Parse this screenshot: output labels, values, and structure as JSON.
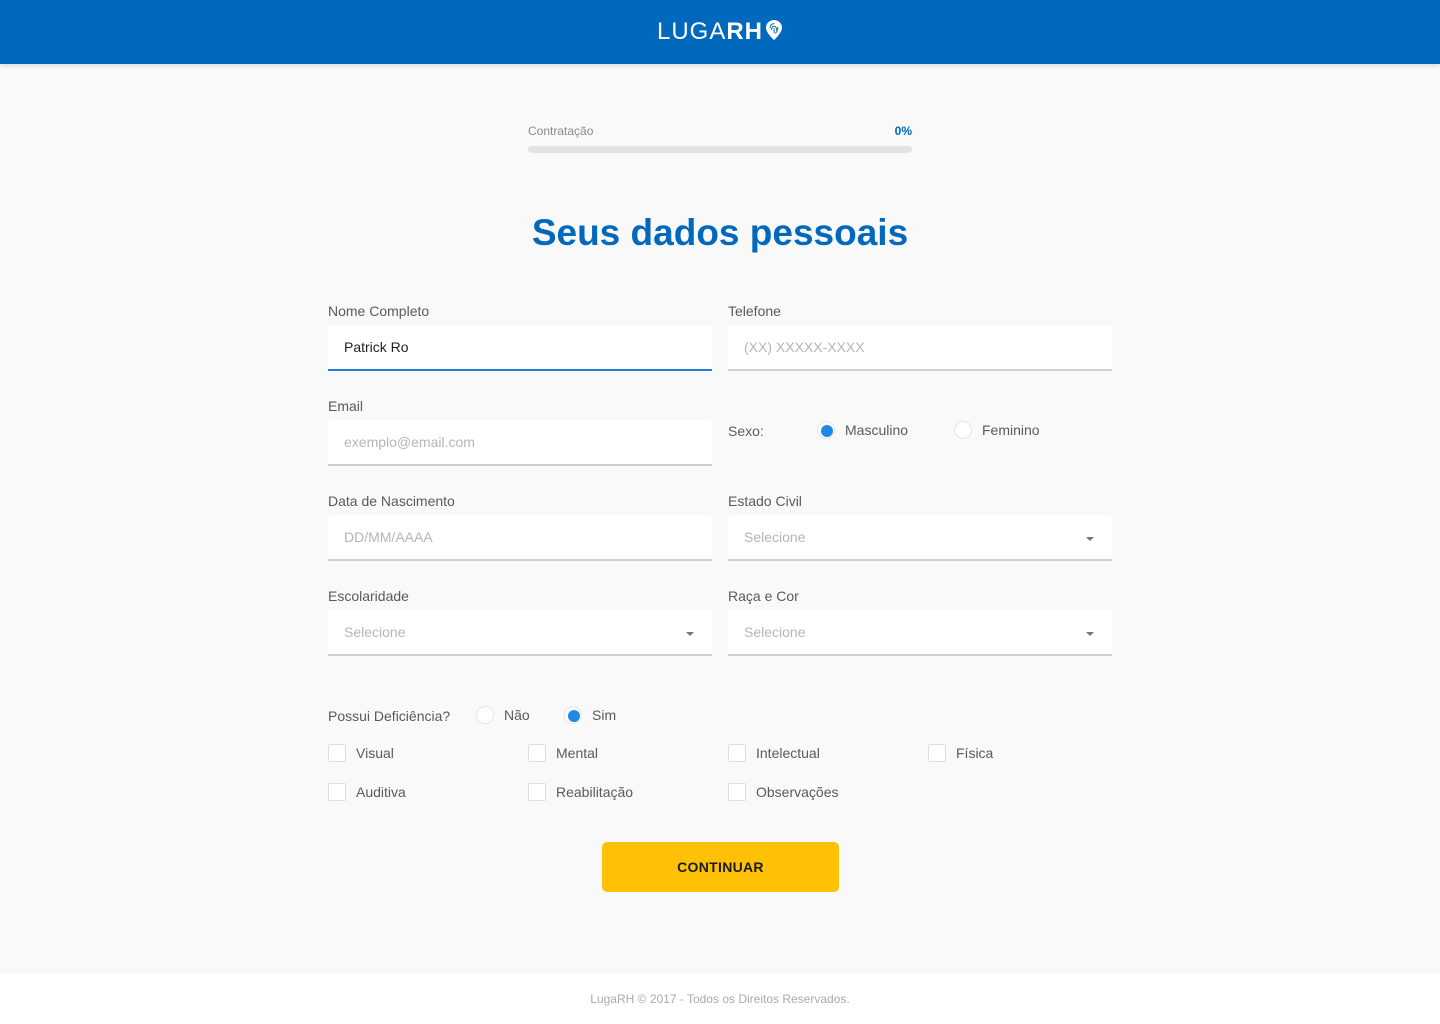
{
  "header": {
    "logo_light": "LUGA",
    "logo_bold": "RH",
    "logo_icon": "location-pin-icon"
  },
  "progress": {
    "label": "Contratação",
    "value_text": "0%",
    "value": 0
  },
  "page": {
    "title": "Seus dados pessoais"
  },
  "form": {
    "nome": {
      "label": "Nome Completo",
      "value": "Patrick Ro"
    },
    "telefone": {
      "label": "Telefone",
      "placeholder": "(XX) XXXXX-XXXX"
    },
    "email": {
      "label": "Email",
      "placeholder": "exemplo@email.com"
    },
    "sexo": {
      "label": "Sexo:",
      "options": [
        "Masculino",
        "Feminino"
      ],
      "selected": "Masculino"
    },
    "nascimento": {
      "label": "Data de Nascimento",
      "placeholder": "DD/MM/AAAA"
    },
    "estado_civil": {
      "label": "Estado Civil",
      "placeholder": "Selecione"
    },
    "escolaridade": {
      "label": "Escolaridade",
      "placeholder": "Selecione"
    },
    "raca": {
      "label": "Raça e Cor",
      "placeholder": "Selecione"
    },
    "deficiencia": {
      "label": "Possui Deficiência?",
      "options": [
        "Não",
        "Sim"
      ],
      "selected": "Sim",
      "types": [
        "Visual",
        "Mental",
        "Intelectual",
        "Física",
        "Auditiva",
        "Reabilitação",
        "Observações"
      ]
    },
    "submit_label": "CONTINUAR"
  },
  "colors": {
    "brand": "#0068bd",
    "accent_button": "#fec106",
    "radio_checked": "#1f88e5"
  },
  "footer": {
    "text": "LugaRH © 2017 - Todos os Direitos Reservados."
  }
}
